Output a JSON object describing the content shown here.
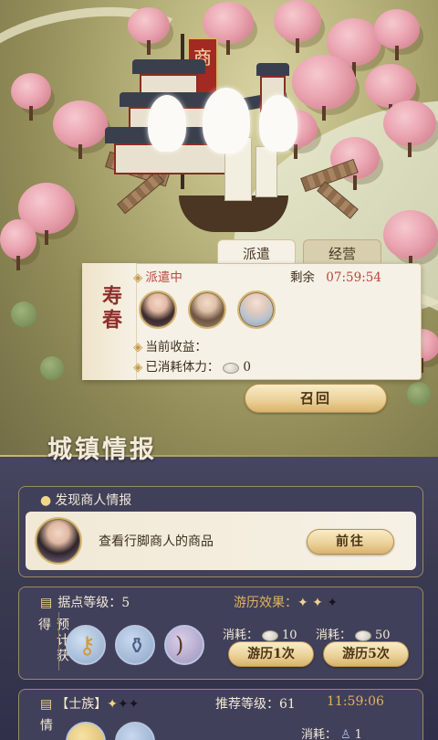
{
  "dispatch": {
    "tabs": [
      {
        "label": "派遣",
        "active": true
      },
      {
        "label": "经营",
        "active": false
      }
    ],
    "city_name": "寿春",
    "status_label": "派遣中",
    "remaining_label": "剩余",
    "remaining_time": "07:59:54",
    "income_label": "当前收益：",
    "stamina_label": "已消耗体力：",
    "stamina_value": "0",
    "recall_button": "召回",
    "avatars": [
      "character-1",
      "character-2",
      "character-3"
    ]
  },
  "city_info": {
    "title": "城镇情报",
    "merchant": {
      "title": "发现商人情报",
      "desc": "查看行脚商人的商品",
      "button": "前往"
    },
    "stronghold": {
      "level_label": "据点等级：5",
      "effect_label": "游历效果：",
      "effect_stars": 2,
      "effect_stars_max": 3,
      "side_label": "预计获得",
      "items": [
        "key-item",
        "vase-item",
        "bow-item"
      ],
      "cost_label_1": "消耗：",
      "cost_value_1": "10",
      "cost_label_2": "消耗：",
      "cost_value_2": "50",
      "button_1": "游历1次",
      "button_5": "游历5次"
    },
    "clan": {
      "label": "【士族】",
      "stars": 1,
      "stars_max": 3,
      "recommend_label": "推荐等级：61",
      "time": "11:59:06",
      "side_label": "情",
      "cost_label": "消耗：",
      "cost_value": "1"
    }
  },
  "colors": {
    "accent_red": "#b8473c",
    "gold": "#e0b35d",
    "panel": "#3a3a51"
  }
}
